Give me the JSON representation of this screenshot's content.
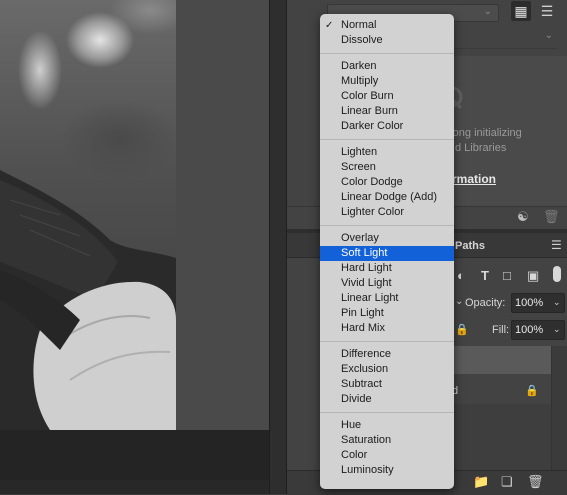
{
  "blend_menu": {
    "checked": "Normal",
    "highlighted": "Soft Light",
    "groups": [
      [
        "Normal",
        "Dissolve"
      ],
      [
        "Darken",
        "Multiply",
        "Color Burn",
        "Linear Burn",
        "Darker Color"
      ],
      [
        "Lighten",
        "Screen",
        "Color Dodge",
        "Linear Dodge (Add)",
        "Lighter Color"
      ],
      [
        "Overlay",
        "Soft Light",
        "Hard Light",
        "Vivid Light",
        "Linear Light",
        "Pin Light",
        "Hard Mix"
      ],
      [
        "Difference",
        "Exclusion",
        "Subtract",
        "Divide"
      ],
      [
        "Hue",
        "Saturation",
        "Color",
        "Luminosity"
      ]
    ]
  },
  "libraries": {
    "message_line1": "rong initializing",
    "message_line2": "d Libraries",
    "link_text": "rmation"
  },
  "layers": {
    "paths_tab": "Paths",
    "opacity_label": "Opacity:",
    "opacity_value": "100%",
    "fill_label": "Fill:",
    "fill_value": "100%",
    "layer2_name_tail": "d"
  },
  "colors": {
    "menu_bg": "#d2d2d2",
    "menu_highlight": "#1361d9",
    "panel_bg": "#434343"
  },
  "icons": {
    "grid_view": "grid-icon",
    "list_view": "list-icon",
    "cloud_error": "cloud-icon",
    "sync": "sync-icon",
    "trash": "trash-icon",
    "lock": "lock-icon"
  }
}
